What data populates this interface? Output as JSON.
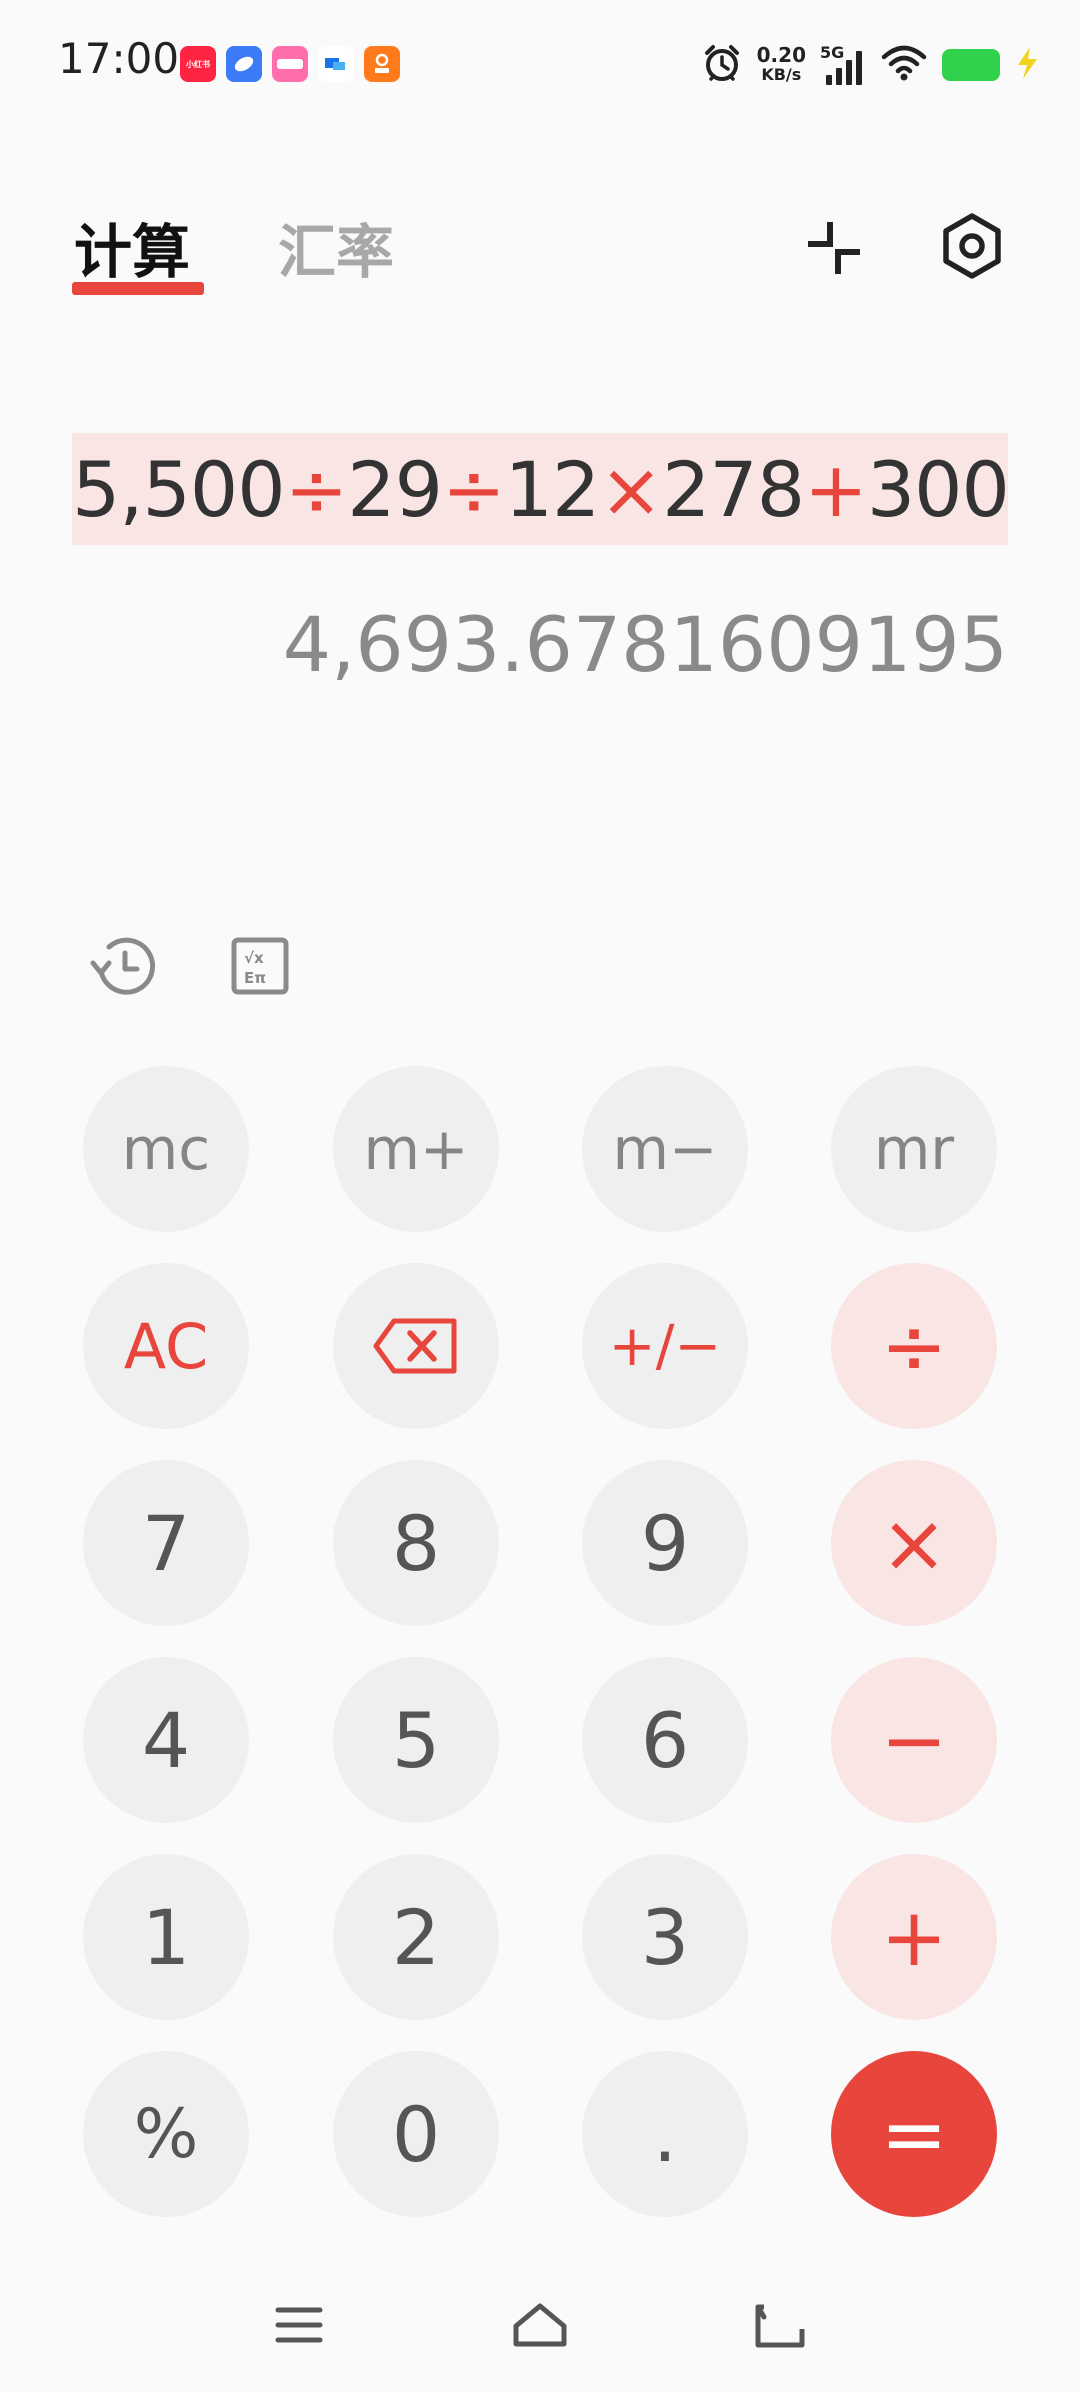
{
  "status_bar": {
    "time": "17:00",
    "notifications": [
      {
        "name": "xiaohongshu-app-icon",
        "label": "小红书",
        "color": "#ff2442"
      },
      {
        "name": "blue-app-icon",
        "label": "",
        "color": "#3b7bf5"
      },
      {
        "name": "pink-app-icon",
        "label": "",
        "color": "#ff6eaa"
      },
      {
        "name": "cloud-app-icon",
        "label": "",
        "color": "#ffffff"
      },
      {
        "name": "orange-app-icon",
        "label": "",
        "color": "#ff7a1a"
      }
    ],
    "net_speed_value": "0.20",
    "net_speed_unit": "KB/s",
    "network_type": "5G",
    "battery_color": "#2fd24a"
  },
  "header": {
    "tab_calculate": "计算",
    "tab_exchange_rate": "汇率",
    "accent_color": "#e8453c"
  },
  "display": {
    "expression_tokens": [
      {
        "text": "5,500",
        "type": "num"
      },
      {
        "text": "÷",
        "type": "op"
      },
      {
        "text": "29",
        "type": "num"
      },
      {
        "text": "÷",
        "type": "op"
      },
      {
        "text": "12",
        "type": "num"
      },
      {
        "text": "×",
        "type": "op"
      },
      {
        "text": "278",
        "type": "num"
      },
      {
        "text": "+",
        "type": "op"
      },
      {
        "text": "300",
        "type": "num"
      }
    ],
    "result": "4,693.6781609195"
  },
  "tools": {
    "history_icon": "history-clock-icon",
    "scientific_icon": "scientific-calculator-icon"
  },
  "keypad": {
    "mc": "mc",
    "m_plus": "m+",
    "m_minus": "m−",
    "mr": "mr",
    "ac": "AC",
    "plus_minus": "+/−",
    "divide": "÷",
    "seven": "7",
    "eight": "8",
    "nine": "9",
    "multiply": "×",
    "four": "4",
    "five": "5",
    "six": "6",
    "minus": "−",
    "one": "1",
    "two": "2",
    "three": "3",
    "plus": "+",
    "percent": "%",
    "zero": "0",
    "decimal": ".",
    "equals": "="
  }
}
